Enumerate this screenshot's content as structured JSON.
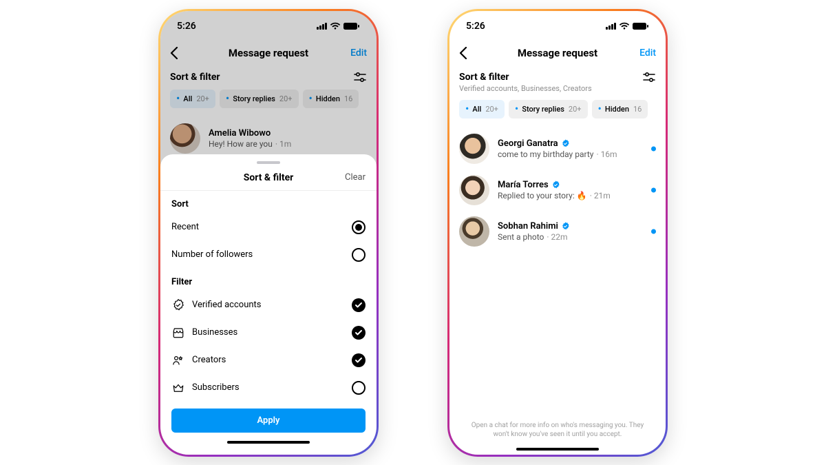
{
  "status": {
    "time": "5:26"
  },
  "header": {
    "title": "Message request",
    "edit": "Edit"
  },
  "sort_filter": {
    "title": "Sort & filter",
    "subtitle": "Verified accounts, Businesses, Creators"
  },
  "chips": [
    {
      "label": "All",
      "count": "20+",
      "active": true
    },
    {
      "label": "Story replies",
      "count": "20+",
      "active": false
    },
    {
      "label": "Hidden",
      "count": "16",
      "active": false
    }
  ],
  "sheet": {
    "title": "Sort & filter",
    "clear": "Clear",
    "sort_label": "Sort",
    "filter_label": "Filter",
    "sort_options": [
      {
        "label": "Recent",
        "selected": true
      },
      {
        "label": "Number of followers",
        "selected": false
      }
    ],
    "filter_options": [
      {
        "label": "Verified accounts",
        "icon": "verified-badge",
        "checked": true
      },
      {
        "label": "Businesses",
        "icon": "storefront",
        "checked": true
      },
      {
        "label": "Creators",
        "icon": "creators",
        "checked": true
      },
      {
        "label": "Subscribers",
        "icon": "crown",
        "checked": false
      }
    ],
    "apply": "Apply"
  },
  "left_messages": [
    {
      "name": "Amelia Wibowo",
      "preview": "Hey! How are you",
      "time": "1m",
      "verified": false
    }
  ],
  "right_messages": [
    {
      "name": "Georgi Ganatra",
      "preview": "come to my birthday party",
      "time": "16m",
      "verified": true,
      "unread": true
    },
    {
      "name": "María Torres",
      "preview": "Replied to your story: 🔥",
      "time": "21m",
      "verified": true,
      "unread": true
    },
    {
      "name": "Sobhan Rahimi",
      "preview": "Sent a photo",
      "time": "22m",
      "verified": true,
      "unread": true
    }
  ],
  "footer_note": "Open a chat for more info on who's messaging you. They won't know you've seen it until you accept."
}
